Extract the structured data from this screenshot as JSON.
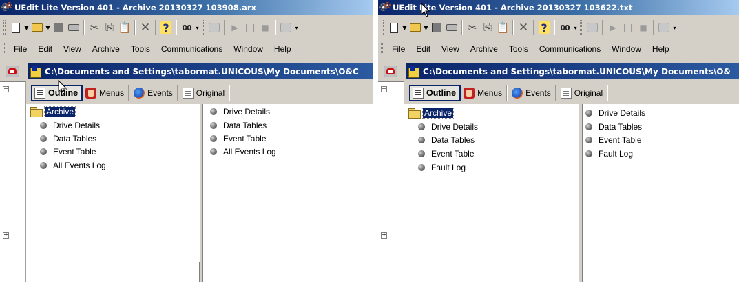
{
  "left_window": {
    "title": "UEdit Lite Version 401 - Archive 20130327 103908.arx",
    "menu": [
      "File",
      "Edit",
      "View",
      "Archive",
      "Tools",
      "Communications",
      "Window",
      "Help"
    ],
    "doc_title": "C:\\Documents and Settings\\tabormat.UNICOUS\\My Documents\\O&C",
    "tabs": [
      {
        "label": "Outline",
        "icon": "outline-icon",
        "active": true
      },
      {
        "label": "Menus",
        "icon": "menus-icon",
        "active": false
      },
      {
        "label": "Events",
        "icon": "events-icon",
        "active": false
      },
      {
        "label": "Original",
        "icon": "original-icon",
        "active": false
      }
    ],
    "tree_root": "Archive",
    "tree_items": [
      "Drive Details",
      "Data Tables",
      "Event Table",
      "All Events Log"
    ],
    "list_items": [
      "Drive Details",
      "Data Tables",
      "Event Table",
      "All Events Log"
    ]
  },
  "right_window": {
    "title": "UEdit Lite Version 401 - Archive 20130327 103622.txt",
    "menu": [
      "File",
      "Edit",
      "View",
      "Archive",
      "Tools",
      "Communications",
      "Window",
      "Help"
    ],
    "doc_title": "C:\\Documents and Settings\\tabormat.UNICOUS\\My Documents\\O&",
    "tabs": [
      {
        "label": "Outline",
        "icon": "outline-icon",
        "active": true
      },
      {
        "label": "Menus",
        "icon": "menus-icon",
        "active": false
      },
      {
        "label": "Events",
        "icon": "events-icon",
        "active": false
      },
      {
        "label": "Original",
        "icon": "original-icon",
        "active": false
      }
    ],
    "tree_root": "Archive",
    "tree_items": [
      "Drive Details",
      "Data Tables",
      "Event Table",
      "Fault Log"
    ],
    "list_items": [
      "Drive Details",
      "Data Tables",
      "Event Table",
      "Fault Log"
    ]
  },
  "colors": {
    "title_bar": "#0a246a",
    "selection": "#0a246a",
    "chrome": "#d4d0c8"
  }
}
